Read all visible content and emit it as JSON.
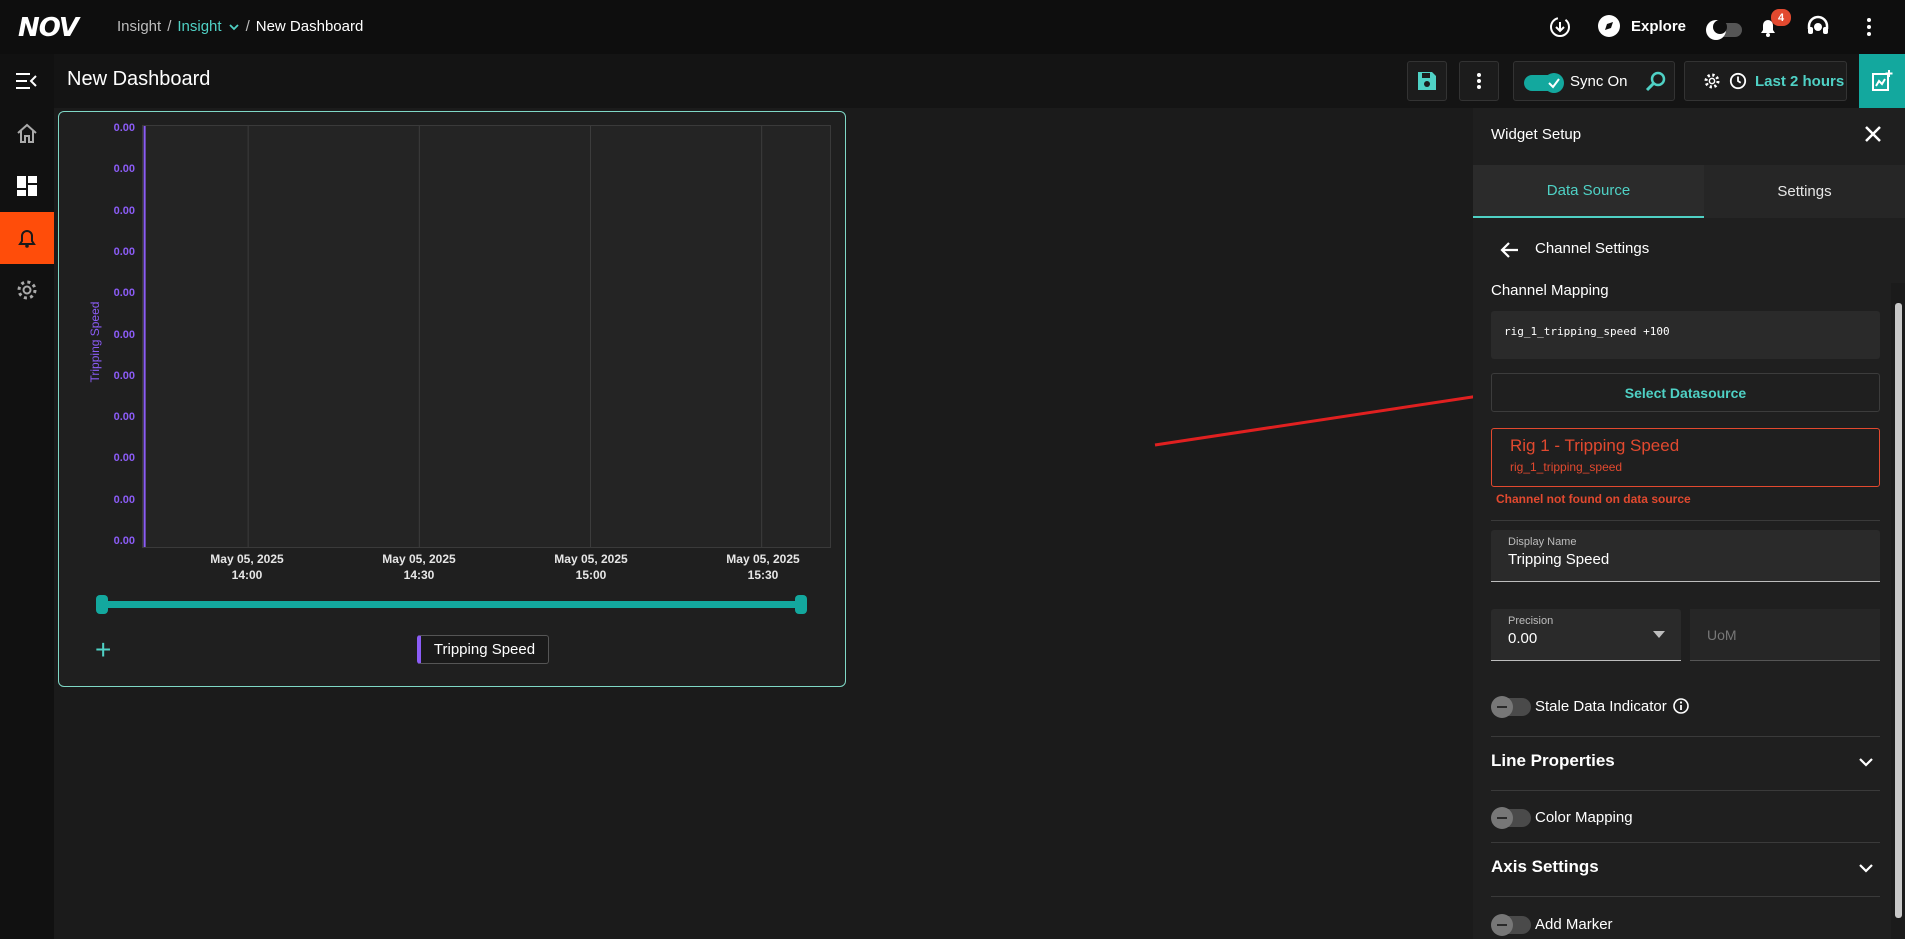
{
  "topbar": {
    "logo": "NOV",
    "breadcrumb": [
      "Insight",
      "/",
      "Insight",
      "/",
      "New Dashboard"
    ],
    "explore_label": "Explore",
    "notification_count": "4"
  },
  "subbar": {
    "title": "New Dashboard",
    "sync_label": "Sync On",
    "time_range": "Last 2 hours"
  },
  "chart_data": {
    "type": "line",
    "ylabel": "Tripping Speed",
    "y_ticks": [
      "0.00",
      "0.00",
      "0.00",
      "0.00",
      "0.00",
      "0.00",
      "0.00",
      "0.00",
      "0.00",
      "0.00",
      "0.00"
    ],
    "x_ticks": [
      {
        "date": "May 05, 2025",
        "time": "14:00"
      },
      {
        "date": "May 05, 2025",
        "time": "14:30"
      },
      {
        "date": "May 05, 2025",
        "time": "15:00"
      },
      {
        "date": "May 05, 2025",
        "time": "15:30"
      }
    ],
    "series": [
      {
        "name": "Tripping Speed",
        "values": []
      }
    ],
    "grid": true,
    "series_color": "#8b5cf6"
  },
  "legend": {
    "label": "Tripping Speed"
  },
  "panel": {
    "title": "Widget Setup",
    "tabs": [
      {
        "label": "Data Source",
        "active": true
      },
      {
        "label": "Settings",
        "active": false
      }
    ],
    "channel_settings": "Channel Settings",
    "channel_mapping_label": "Channel Mapping",
    "channel_mapping_value": "rig_1_tripping_speed +100",
    "select_datasource": "Select Datasource",
    "error_title": "Rig 1 - Tripping Speed",
    "error_sub": "rig_1_tripping_speed",
    "error_msg": "Channel not found on data source",
    "display_name_label": "Display Name",
    "display_name_value": "Tripping Speed",
    "precision_label": "Precision",
    "precision_value": "0.00",
    "uom_placeholder": "UoM",
    "stale_label": "Stale Data Indicator",
    "line_properties": "Line Properties",
    "color_mapping": "Color Mapping",
    "axis_settings": "Axis Settings",
    "add_marker": "Add Marker"
  },
  "colors": {
    "accent": "#4fd1c5",
    "error": "#e2492f",
    "series": "#8b5cf6"
  }
}
